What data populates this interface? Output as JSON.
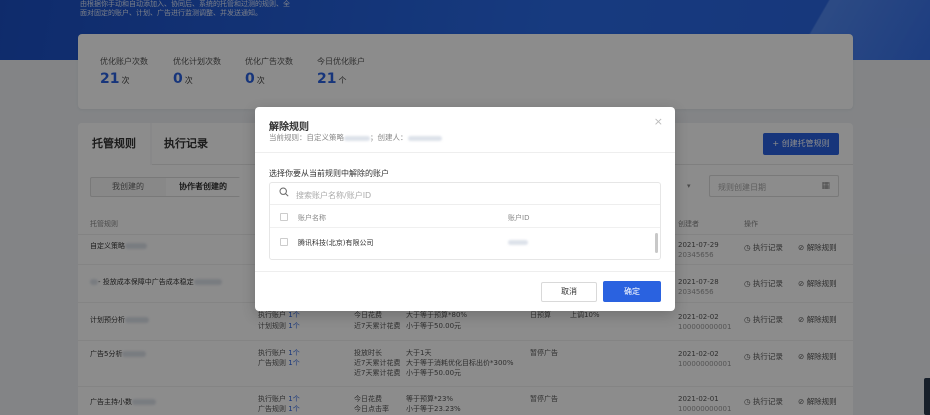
{
  "hero": {
    "line1": "由根据你手动和自动添加入、协同后、系统的托管和过测的规则、全",
    "line2": "面对固定的账户、计划、广告进行监测调整、并发送通知。"
  },
  "stats": [
    {
      "label": "优化账户次数",
      "value": "21",
      "unit": "次"
    },
    {
      "label": "优化计划次数",
      "value": "0",
      "unit": "次"
    },
    {
      "label": "优化广告次数",
      "value": "0",
      "unit": "次"
    },
    {
      "label": "今日优化账户",
      "value": "21",
      "unit": "个"
    }
  ],
  "tabs": {
    "hosting": "托管规则",
    "records": "执行记录"
  },
  "create_button": "+ 创建托管规则",
  "segment": {
    "mine": "我创建的",
    "collab": "协作者创建的"
  },
  "filter": {
    "date_placeholder": "规则创建日期"
  },
  "table": {
    "headers": {
      "name": "托管规则",
      "creator": "创建者",
      "ops": "操作"
    },
    "rows": [
      {
        "name": "自定义策略",
        "c1": "",
        "c2": "",
        "c3": "",
        "date": "2021-07-29",
        "id": "20345656"
      },
      {
        "name": "- 投放成本保障中广告成本稳定",
        "c1": "",
        "c2": "",
        "c3": "",
        "date": "2021-07-28",
        "id": "20345656"
      },
      {
        "name": "计划预分析",
        "c1a": "执行账户 ",
        "c1a_n": "1个",
        "c1b": "计划规则 ",
        "c1b_n": "1个",
        "c2a": "今日花费",
        "c2b": "近7天累计花费",
        "c3a": "大于等于预算*80%",
        "c3b": "小于等于50.00元",
        "c4": "日预算",
        "c5": "上调10%",
        "date": "2021-02-02",
        "id": "100000000001"
      },
      {
        "name": "广告5分析",
        "c1a": "执行账户 ",
        "c1a_n": "1个",
        "c1b": "广告规则 ",
        "c1b_n": "1个",
        "c2a": "投放时长",
        "c2b": "近7天累计花费",
        "c2c": "近7天累计花费",
        "c3a": "大于1天",
        "c3b": "大于等于消耗优化目标出价*300%",
        "c3c": "小于等于50.00元",
        "c4": "暂停广告",
        "c5": "",
        "date": "2021-02-02",
        "id": "100000000001"
      },
      {
        "name": "广告主持小数",
        "c1a": "执行账户 ",
        "c1a_n": "1个",
        "c1b": "广告规则 ",
        "c1b_n": "1个",
        "c2a": "今日花费",
        "c2b": "今日点击率",
        "c3a": "等于预算*23%",
        "c3b": "小于等于23.23%",
        "c4": "暂停广告",
        "c5": "",
        "date": "2021-02-01",
        "id": "100000000001"
      }
    ],
    "action_records": "执行记录",
    "action_remove": "解除规则"
  },
  "modal": {
    "title": "解除规则",
    "subtitle_rule": "当前规则：自定义策略",
    "subtitle_creator": "；创建人：",
    "prompt": "选择你要从当前规则中解除的账户",
    "search_placeholder": "搜索账户名称/账户ID",
    "col_name": "账户名称",
    "col_id": "账户ID",
    "account_name": "腾讯科技(北京)有限公司",
    "cancel": "取消",
    "confirm": "确定",
    "close": "×"
  }
}
